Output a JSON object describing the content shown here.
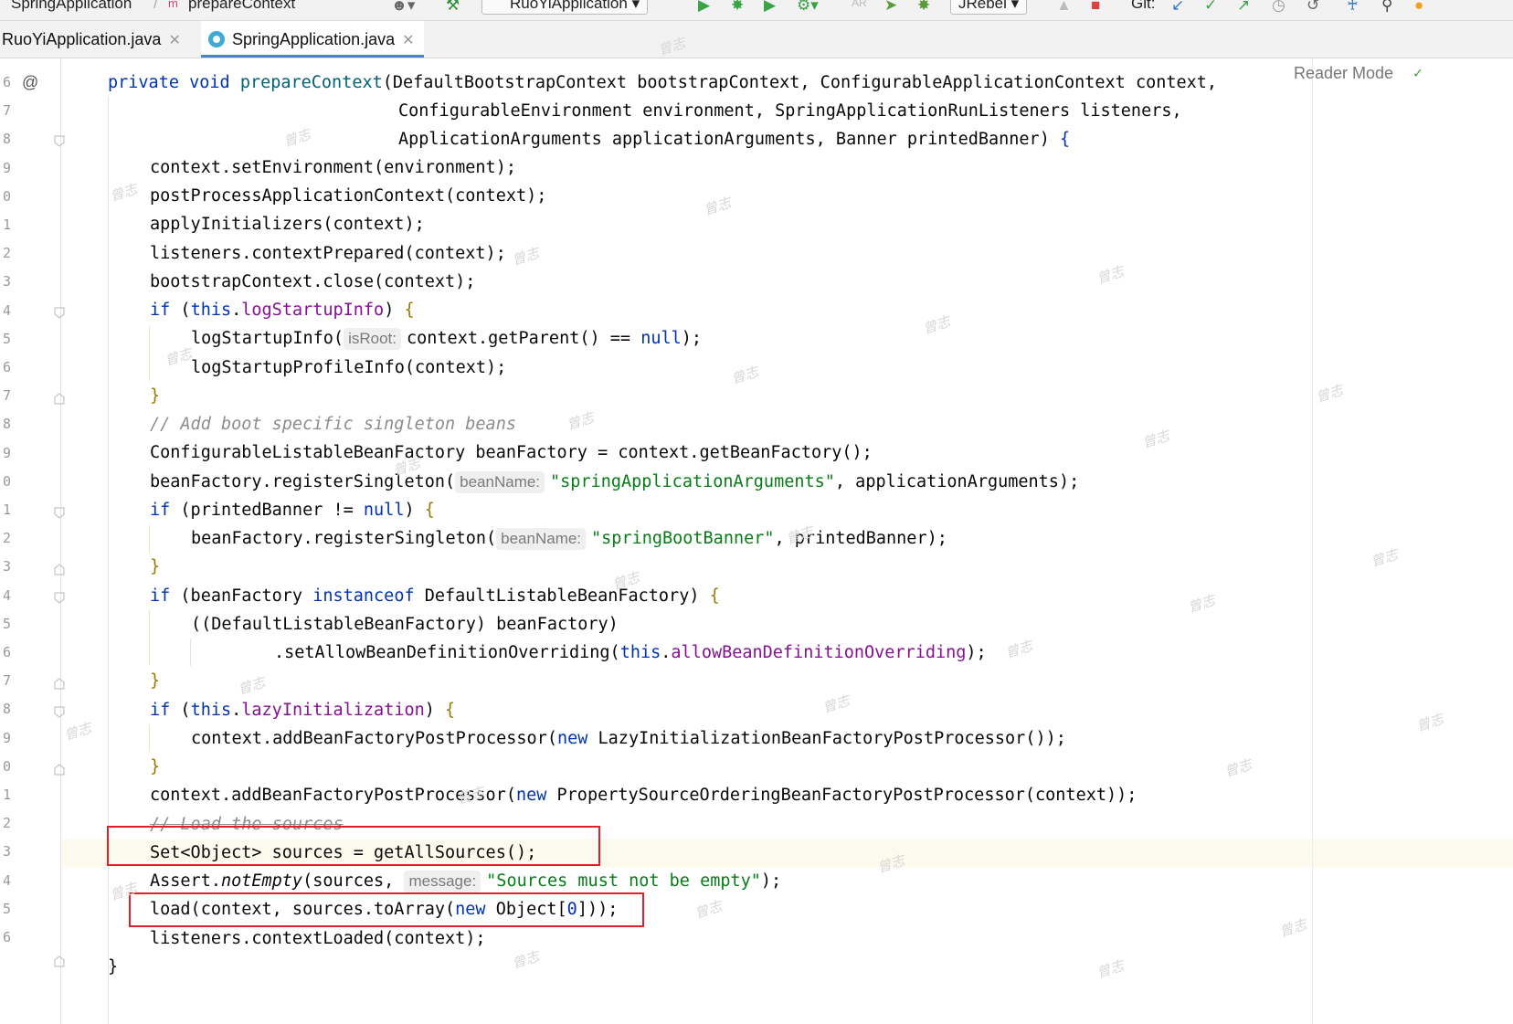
{
  "toolbar": {
    "breadcrumb_class": "SpringApplication",
    "breadcrumb_method_badge": "m",
    "breadcrumb_method": "prepareContext",
    "run_config": "RuoYiApplication",
    "jrebel": "JRebel",
    "git_label": "Git:"
  },
  "tabs": [
    {
      "label": "RuoYiApplication.java",
      "active": false
    },
    {
      "label": "SpringApplication.java",
      "active": true
    }
  ],
  "editor": {
    "reader_mode": "Reader Mode",
    "gutter_line_numbers": [
      "6",
      "7",
      "8",
      "9",
      "0",
      "1",
      "2",
      "3",
      "4",
      "5",
      "6",
      "7",
      "8",
      "9",
      "0",
      "1",
      "2",
      "3",
      "4",
      "5",
      "6",
      "7",
      "8",
      "9",
      "0",
      "1",
      "2",
      "3",
      "4",
      "5",
      "6"
    ],
    "code": {
      "l1": {
        "kw1": "private",
        "kw2": "void",
        "name": "prepareContext",
        "rest": "(DefaultBootstrapContext bootstrapContext, ConfigurableApplicationContext context,"
      },
      "l2": "ConfigurableEnvironment environment, SpringApplicationRunListeners listeners,",
      "l3": {
        "text": "ApplicationArguments applicationArguments, Banner printedBanner) ",
        "brace": "{"
      },
      "l4": "context.setEnvironment(environment);",
      "l5": "postProcessApplicationContext(context);",
      "l6": "applyInitializers(context);",
      "l7": "listeners.contextPrepared(context);",
      "l8": "bootstrapContext.close(context);",
      "l9": {
        "kw": "if",
        "open": " (",
        "this": "this",
        "dot": ".",
        "field": "logStartupInfo",
        "close": ") ",
        "brace": "{"
      },
      "l10": {
        "pre": "logStartupInfo(",
        "hint": "isRoot:",
        "post": "context.getParent() == ",
        "kw": "null",
        "end": ");"
      },
      "l11": "logStartupProfileInfo(context);",
      "l12": "}",
      "l13": "// Add boot specific singleton beans",
      "l14": "ConfigurableListableBeanFactory beanFactory = context.getBeanFactory();",
      "l15": {
        "pre": "beanFactory.registerSingleton(",
        "hint": "beanName:",
        "str": "\"springApplicationArguments\"",
        "post": ", applicationArguments);"
      },
      "l16": {
        "kw": "if",
        "pre": " (printedBanner != ",
        "kw2": "null",
        "post": ") ",
        "brace": "{"
      },
      "l17": {
        "pre": "beanFactory.registerSingleton(",
        "hint": "beanName:",
        "str": "\"springBootBanner\"",
        "post": ", printedBanner);"
      },
      "l18": "}",
      "l19": {
        "kw": "if",
        "pre": " (beanFactory ",
        "kw2": "instanceof",
        "post": " DefaultListableBeanFactory) ",
        "brace": "{"
      },
      "l20": "((DefaultListableBeanFactory) beanFactory)",
      "l21": {
        "pre": ".setAllowBeanDefinitionOverriding(",
        "this": "this",
        "dot": ".",
        "field": "allowBeanDefinitionOverriding",
        "post": ");"
      },
      "l22": "}",
      "l23": {
        "kw": "if",
        "open": " (",
        "this": "this",
        "dot": ".",
        "field": "lazyInitialization",
        "close": ") ",
        "brace": "{"
      },
      "l24": {
        "pre": "context.addBeanFactoryPostProcessor(",
        "kw": "new",
        "post": " LazyInitializationBeanFactoryPostProcessor());"
      },
      "l25": "}",
      "l26": {
        "pre": "context.addBeanFactoryPostProcessor(",
        "kw": "new",
        "post": " PropertySourceOrderingBeanFactoryPostProcessor(context));"
      },
      "l27": "// Load the sources",
      "l28": "Set<Object> sources = getAllSources();",
      "l29": {
        "pre": "Assert.",
        "method": "notEmpty",
        "mid": "(sources, ",
        "hint": "message:",
        "str": "\"Sources must not be empty\"",
        "post": ");"
      },
      "l30": {
        "pre": "load(context, sources.toArray(",
        "kw": "new",
        "mid": " Object[",
        "num": "0",
        "post": "]));"
      },
      "l31": "listeners.contextLoaded(context);",
      "l32": "}"
    }
  },
  "watermark_text": "曾志",
  "colors": {
    "keyword": "#0033b3",
    "method_decl": "#00627a",
    "field": "#871094",
    "string": "#067d17",
    "comment": "#8c8c8c",
    "highlight_box": "#e01f2a",
    "current_line": "#fcfaed"
  }
}
